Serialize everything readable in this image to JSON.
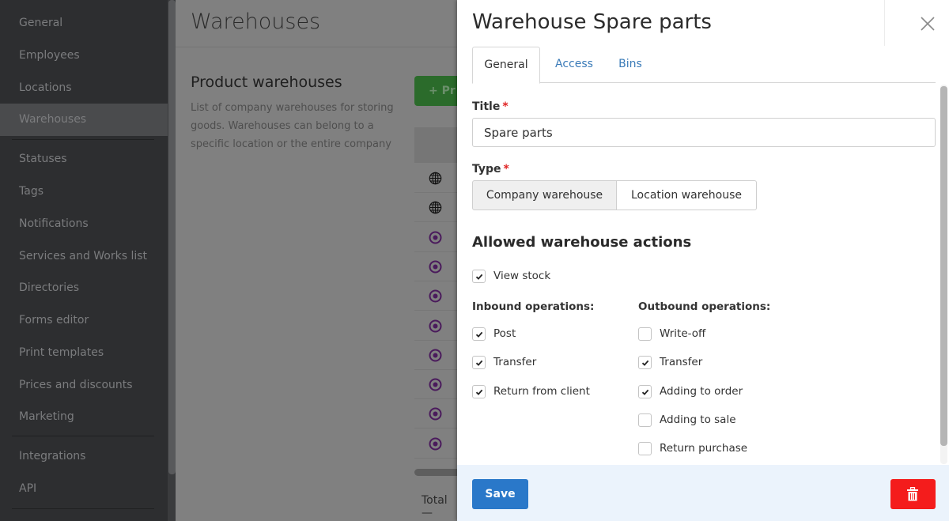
{
  "sidebar": {
    "items": [
      {
        "label": "General"
      },
      {
        "label": "Employees"
      },
      {
        "label": "Locations"
      },
      {
        "label": "Warehouses",
        "active": true
      },
      {
        "label": "Statuses"
      },
      {
        "label": "Tags"
      },
      {
        "label": "Notifications"
      },
      {
        "label": "Services and Works list"
      },
      {
        "label": "Directories"
      },
      {
        "label": "Forms editor"
      },
      {
        "label": "Print templates"
      },
      {
        "label": "Prices and discounts"
      },
      {
        "label": "Marketing"
      },
      {
        "label": "Integrations"
      },
      {
        "label": "API"
      }
    ]
  },
  "main": {
    "title": "Warehouses",
    "section_title": "Product warehouses",
    "section_description": "List of company warehouses for storing goods. Warehouses can belong to a specific location or the entire company",
    "add_button_label": "+ Pr",
    "rows": [
      {
        "icon": "globe-icon"
      },
      {
        "icon": "globe-icon"
      },
      {
        "icon": "location-target-icon"
      },
      {
        "icon": "location-target-icon"
      },
      {
        "icon": "location-target-icon"
      },
      {
        "icon": "location-target-icon"
      },
      {
        "icon": "location-target-icon"
      },
      {
        "icon": "location-target-icon"
      },
      {
        "icon": "location-target-icon"
      },
      {
        "icon": "location-target-icon"
      }
    ],
    "total_label": "Total —"
  },
  "panel": {
    "title": "Warehouse Spare parts",
    "tabs": [
      {
        "label": "General",
        "active": true
      },
      {
        "label": "Access"
      },
      {
        "label": "Bins"
      }
    ],
    "title_label": "Title",
    "required_mark": "*",
    "title_value": "Spare parts",
    "type_label": "Type",
    "type_options": [
      {
        "label": "Company warehouse",
        "selected": true
      },
      {
        "label": "Location warehouse",
        "selected": false
      }
    ],
    "actions_heading": "Allowed warehouse actions",
    "view_stock": {
      "label": "View stock",
      "checked": true
    },
    "inbound_heading": "Inbound operations:",
    "inbound": [
      {
        "label": "Post",
        "checked": true
      },
      {
        "label": "Transfer",
        "checked": true
      },
      {
        "label": "Return from client",
        "checked": true
      }
    ],
    "outbound_heading": "Outbound operations:",
    "outbound": [
      {
        "label": "Write-off",
        "checked": false
      },
      {
        "label": "Transfer",
        "checked": true
      },
      {
        "label": "Adding to order",
        "checked": true
      },
      {
        "label": "Adding to sale",
        "checked": false
      },
      {
        "label": "Return purchase",
        "checked": false
      }
    ],
    "save_label": "Save",
    "colors": {
      "save": "#2a78c9",
      "delete": "#f41c1c",
      "required": "#e02424",
      "tab_link": "#3b7bb8",
      "footer_bg": "#ebf3fc"
    }
  }
}
